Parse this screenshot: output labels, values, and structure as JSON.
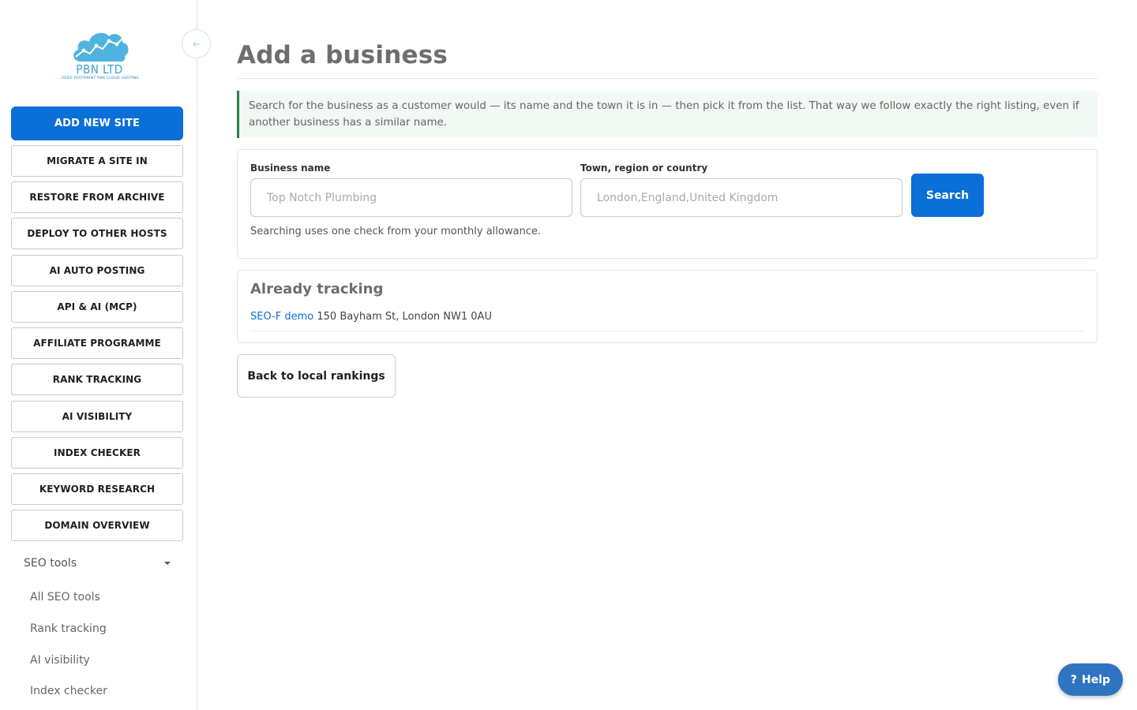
{
  "brand": {
    "name": "PBN LTD",
    "tagline": "ZERO FOOTPRINT PBN CLOUD HOSTING",
    "color": "#3aa0c8"
  },
  "sidebar": {
    "collapse_icon": "arrow-left-icon",
    "primary_button": "ADD NEW SITE",
    "buttons": [
      "MIGRATE A SITE IN",
      "RESTORE FROM ARCHIVE",
      "DEPLOY TO OTHER HOSTS",
      "AI AUTO POSTING",
      "API & AI (MCP)",
      "AFFILIATE PROGRAMME",
      "RANK TRACKING",
      "AI VISIBILITY",
      "INDEX CHECKER",
      "KEYWORD RESEARCH",
      "DOMAIN OVERVIEW"
    ],
    "group": {
      "label": "SEO tools",
      "items": [
        "All SEO tools",
        "Rank tracking",
        "AI visibility",
        "Index checker"
      ]
    }
  },
  "main": {
    "title": "Add a business",
    "info": "Search for the business as a customer would — its name and the town it is in — then pick it from the list. That way we follow exactly the right listing, even if another business has a similar name.",
    "search": {
      "business_label": "Business name",
      "business_placeholder": "Top Notch Plumbing",
      "location_label": "Town, region or country",
      "location_placeholder": "London,England,United Kingdom",
      "button": "Search",
      "hint": "Searching uses one check from your monthly allowance."
    },
    "tracking": {
      "title": "Already tracking",
      "items": [
        {
          "name": "SEO-F demo",
          "address": "150 Bayham St, London NW1 0AU"
        }
      ]
    },
    "back_button": "Back to local rankings"
  },
  "help": {
    "icon": "?",
    "label": "Help"
  },
  "colors": {
    "accent": "#0b6fd8",
    "info_border": "#2e7d46",
    "info_bg": "#f2f8f3"
  }
}
